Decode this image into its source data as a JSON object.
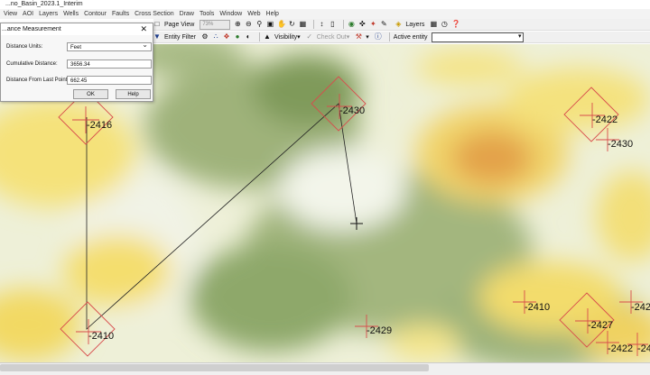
{
  "window": {
    "title": "...no_Basin_2023.1_Interim"
  },
  "menu": [
    "View",
    "AOI",
    "Layers",
    "Wells",
    "Contour",
    "Faults",
    "Cross Section",
    "Draw",
    "Tools",
    "Window",
    "Web",
    "Help"
  ],
  "toolbar1": {
    "page_view": "Page View",
    "zoom": "73%",
    "layers": "Layers"
  },
  "toolbar2": {
    "entity_filter": "Entity Filter",
    "visibility": "Visibility",
    "check_out": "Check Out",
    "active_entity_label": "Active entity",
    "active_entity_value": ""
  },
  "dialog": {
    "title": "...ance Measurement",
    "units_label": "Distance Units:",
    "units_value": "Feet",
    "cumulative_label": "Cumulative Distance:",
    "cumulative_value": "3656.34",
    "last_point_label": "Distance From Last Point:",
    "last_point_value": "662.45",
    "ok": "OK",
    "help": "Help"
  },
  "map": {
    "wells": [
      {
        "label": "-2416"
      },
      {
        "label": "-2430"
      },
      {
        "label": "-2422"
      },
      {
        "label": "-2430"
      },
      {
        "label": "-2410"
      },
      {
        "label": "-2410"
      },
      {
        "label": "-2429"
      },
      {
        "label": "-2427"
      },
      {
        "label": "-2422"
      },
      {
        "label": "-242"
      },
      {
        "label": "-24"
      }
    ]
  }
}
